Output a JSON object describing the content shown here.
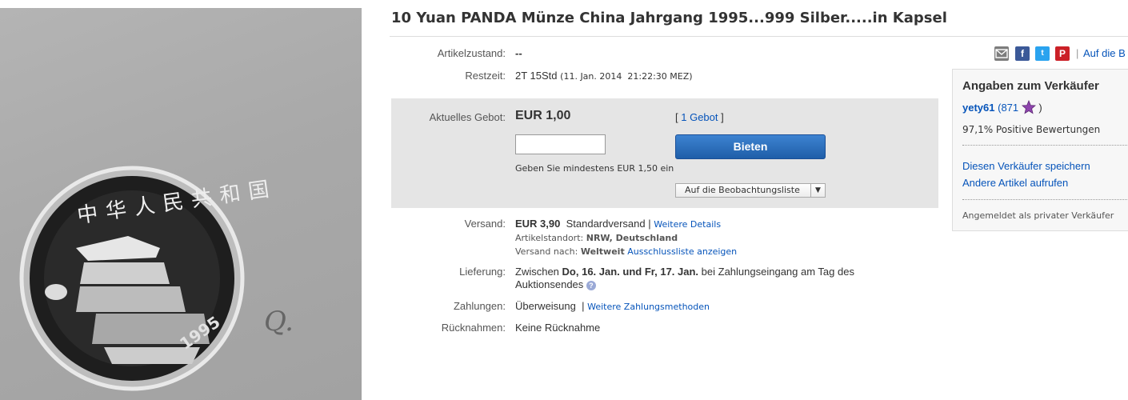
{
  "listing": {
    "title": "10 Yuan PANDA Münze China Jahrgang 1995...999 Silber.....in Kapsel"
  },
  "photo": {
    "coin_inscription": "中华人民共和国",
    "coin_year": "1995",
    "handwriting": "Q."
  },
  "details": {
    "condition_label": "Artikelzustand:",
    "condition_value": "--",
    "remaining_label": "Restzeit:",
    "remaining_value": "2T 15Std",
    "remaining_date": "(11. Jan. 2014  21:22:30 MEZ)"
  },
  "bid": {
    "current_label": "Aktuelles Gebot:",
    "current_value": "EUR 1,00",
    "bid_count_open": "[",
    "bid_count_link": "1 Gebot",
    "bid_count_close": "]",
    "input_value": "",
    "button_label": "Bieten",
    "min_hint": "Geben Sie mindestens EUR 1,50 ein",
    "watch_label": "Auf die Beobachtungsliste"
  },
  "shipping": {
    "label": "Versand:",
    "cost": "EUR 3,90",
    "method": "Standardversand |",
    "details_link": "Weitere Details",
    "location_label": "Artikelstandort:",
    "location_value": "NRW, Deutschland",
    "ships_to_label": "Versand nach:",
    "ships_to_value": "Weltweit",
    "exclusion_link": "Ausschlussliste anzeigen"
  },
  "delivery": {
    "label": "Lieferung:",
    "prefix": "Zwischen",
    "dates": "Do, 16. Jan. und Fr, 17. Jan.",
    "suffix": "bei Zahlungseingang am Tag des",
    "line2": "Auktionsendes",
    "help_icon": "?"
  },
  "payment": {
    "label": "Zahlungen:",
    "value": "Überweisung",
    "sep": "|",
    "more_link": "Weitere Zahlungsmethoden"
  },
  "returns": {
    "label": "Rücknahmen:",
    "value": "Keine Rücknahme"
  },
  "share": {
    "icons": [
      "email-icon",
      "facebook-icon",
      "twitter-icon",
      "pinterest-icon"
    ],
    "sep": "|",
    "watch_link": "Auf die B"
  },
  "seller": {
    "heading": "Angaben zum Verkäufer",
    "name": "yety61",
    "rating_open": "(871",
    "rating_close": ")",
    "positive": "97,1% Positive Bewertungen",
    "save_link": "Diesen Verkäufer speichern",
    "other_items_link": "Andere Artikel aufrufen",
    "account_type": "Angemeldet als privater Verkäufer"
  },
  "colors": {
    "link": "#0654ba",
    "bid_button": "#2a6cbf",
    "star": "#8e44ad"
  }
}
